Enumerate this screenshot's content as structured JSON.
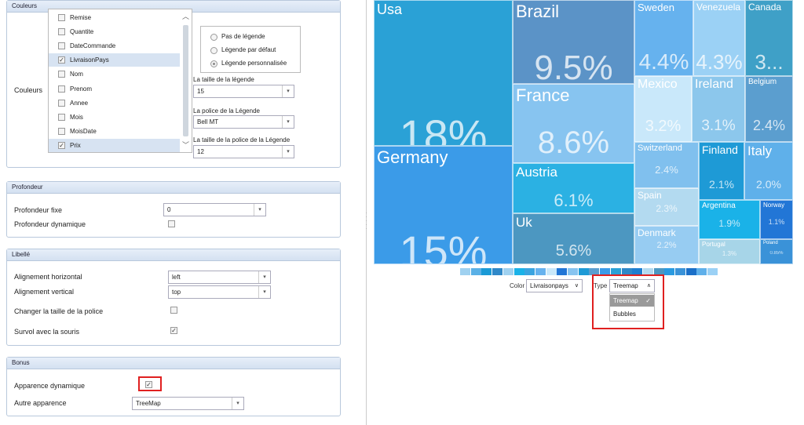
{
  "left": {
    "couleurs": {
      "title": "Couleurs",
      "label": "Couleurs",
      "items": [
        {
          "label": "Remise",
          "checked": false
        },
        {
          "label": "Quantite",
          "checked": false
        },
        {
          "label": "DateCommande",
          "checked": false
        },
        {
          "label": "LivraisonPays",
          "checked": true
        },
        {
          "label": "Nom",
          "checked": false
        },
        {
          "label": "Prenom",
          "checked": false
        },
        {
          "label": "Annee",
          "checked": false
        },
        {
          "label": "Mois",
          "checked": false
        },
        {
          "label": "MoisDate",
          "checked": false
        },
        {
          "label": "Prix",
          "checked": true
        }
      ],
      "legend_options": [
        "Pas de légende",
        "Légende par défaut",
        "Légende personnalisée"
      ],
      "legend_selected": "Légende personnalisée",
      "legend_size_label": "La taille de la légende",
      "legend_size_value": "15",
      "legend_font_label": "La police de la Légende",
      "legend_font_value": "Bell MT",
      "legend_font_size_label": "La taille de la police de la Légende",
      "legend_font_size_value": "12"
    },
    "profondeur": {
      "title": "Profondeur",
      "fixed_label": "Profondeur fixe",
      "fixed_value": "0",
      "dynamic_label": "Profondeur dynamique",
      "dynamic_checked": false
    },
    "libelle": {
      "title": "Libellé",
      "h_label": "Alignement horizontal",
      "h_value": "left",
      "v_label": "Alignement vertical",
      "v_value": "top",
      "font_size_label": "Changer la taille de la police",
      "font_size_checked": false,
      "hover_label": "Survol avec la souris",
      "hover_checked": true
    },
    "bonus": {
      "title": "Bonus",
      "dynamic_label": "Apparence dynamique",
      "dynamic_checked": true,
      "other_label": "Autre apparence",
      "other_value": "TreeMap"
    }
  },
  "treemap": {
    "tiles": [
      {
        "name": "Usa",
        "pct": "18%",
        "color": "#2aa1d6"
      },
      {
        "name": "Germany",
        "pct": "15%",
        "color": "#3b9be8"
      },
      {
        "name": "Brazil",
        "pct": "9.5%",
        "color": "#5b93c7"
      },
      {
        "name": "France",
        "pct": "8.6%",
        "color": "#87c4f0"
      },
      {
        "name": "Austria",
        "pct": "6.1%",
        "color": "#2bb1e3"
      },
      {
        "name": "Uk",
        "pct": "5.6%",
        "color": "#4c97c1"
      },
      {
        "name": "Sweden",
        "pct": "4.4%",
        "color": "#66b2ee"
      },
      {
        "name": "Venezuela",
        "pct": "4.3%",
        "color": "#9bd1f5"
      },
      {
        "name": "Canada",
        "pct": "3...",
        "color": "#3fa0c7"
      },
      {
        "name": "Mexico",
        "pct": "3.2%",
        "color": "#c9e8fa"
      },
      {
        "name": "Ireland",
        "pct": "3.1%",
        "color": "#8cc7ec"
      },
      {
        "name": "Belgium",
        "pct": "2.4%",
        "color": "#5b9ecf"
      },
      {
        "name": "Switzerland",
        "pct": "2.4%",
        "color": "#80c0ee"
      },
      {
        "name": "Finland",
        "pct": "2.1%",
        "color": "#1e9ad6"
      },
      {
        "name": "Italy",
        "pct": "2.0%",
        "color": "#5fb0ea"
      },
      {
        "name": "Spain",
        "pct": "2.3%",
        "color": "#b3daf0"
      },
      {
        "name": "Argentina",
        "pct": "1.9%",
        "color": "#1ab2e8"
      },
      {
        "name": "Norway",
        "pct": "1.1%",
        "color": "#2276d6"
      },
      {
        "name": "Denmark",
        "pct": "2.2%",
        "color": "#97ccf2"
      },
      {
        "name": "Portugal",
        "pct": "1.3%",
        "color": "#a7d5e8"
      },
      {
        "name": "Poland",
        "pct": "0.85%",
        "color": "#3a92d8"
      }
    ],
    "swatches": [
      "#9fd1f0",
      "#5ab0e6",
      "#1a9ad6",
      "#2f88c8",
      "#9fd1f0",
      "#1ab2e8",
      "#3aa4e0",
      "#66b2ee",
      "#c9e8fa",
      "#2276d6",
      "#87c4f0",
      "#1e9ad6",
      "#5b9ecf",
      "#3b9be8",
      "#2aa1d6",
      "#2f88c8",
      "#1e7ed0",
      "#b3daf0",
      "#4c97c1",
      "#2a9ae0",
      "#3a92d8",
      "#1a6fc8",
      "#5fb0ea",
      "#9bd1f5"
    ],
    "color_label": "Color",
    "color_value": "Livraisonpays",
    "type_label": "Type",
    "type_value": "Treemap",
    "type_options": [
      "Treemap",
      "Bubbles"
    ],
    "type_selected": "Treemap"
  }
}
